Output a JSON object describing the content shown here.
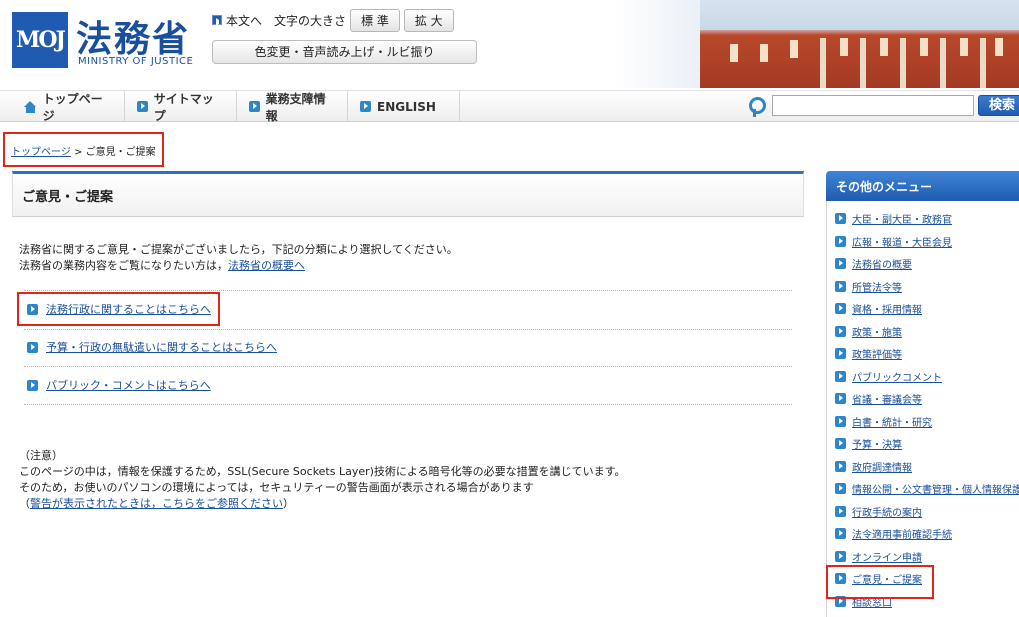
{
  "header": {
    "logo_mark": "MOJ",
    "title": "法務省",
    "subtitle": "MINISTRY OF JUSTICE",
    "skip_to_main": "本文へ",
    "font_size_label": "文字の大きさ",
    "font_standard": "標 準",
    "font_large": "拡 大",
    "accessibility_button": "色変更・音声読み上げ・ルビ振り"
  },
  "nav": {
    "items": [
      "トップページ",
      "サイトマップ",
      "業務支障情報",
      "ENGLISH"
    ],
    "search_placeholder": "",
    "search_button": "検索"
  },
  "breadcrumb": {
    "home": "トップページ",
    "separator": ">",
    "current": "ご意見・ご提案"
  },
  "main": {
    "title": "ご意見・ご提案",
    "intro_line1": "法務省に関するご意見・ご提案がございましたら，下記の分類により選択してください。",
    "intro_line2_prefix": "法務省の業務内容をご覧になりたい方は，",
    "intro_line2_link": "法務省の概要へ",
    "links": [
      "法務行政に関することはこちらへ",
      "予算・行政の無駄遣いに関することはこちらへ",
      "パブリック・コメントはこちらへ"
    ],
    "notice_title": "（注意）",
    "notice_line1": "このページの中は，情報を保護するため，SSL(Secure Sockets Layer)技術による暗号化等の必要な措置を講じています。",
    "notice_line2": "そのため，お使いのパソコンの環境によっては，セキュリティーの警告画面が表示される場合があります",
    "notice_line3_open": "（",
    "notice_line3_link": "警告が表示されたときは，こちらをご参照ください",
    "notice_line3_close": "）"
  },
  "side_menu": {
    "title": "その他のメニュー",
    "items": [
      "大臣・副大臣・政務官",
      "広報・報道・大臣会見",
      "法務省の概要",
      "所管法令等",
      "資格・採用情報",
      "政策・施策",
      "政策評価等",
      "パブリックコメント",
      "省議・審議会等",
      "白書・統計・研究",
      "予算・決算",
      "政府調達情報",
      "情報公開・公文書管理・個人情報保護",
      "行政手続の案内",
      "法令適用事前確認手続",
      "オンライン申請",
      "ご意見・ご提案",
      "相談窓口"
    ]
  },
  "colors": {
    "brand_blue": "#1f5bb0",
    "link": "#1a4f9c",
    "highlight_red": "#e0251b"
  }
}
